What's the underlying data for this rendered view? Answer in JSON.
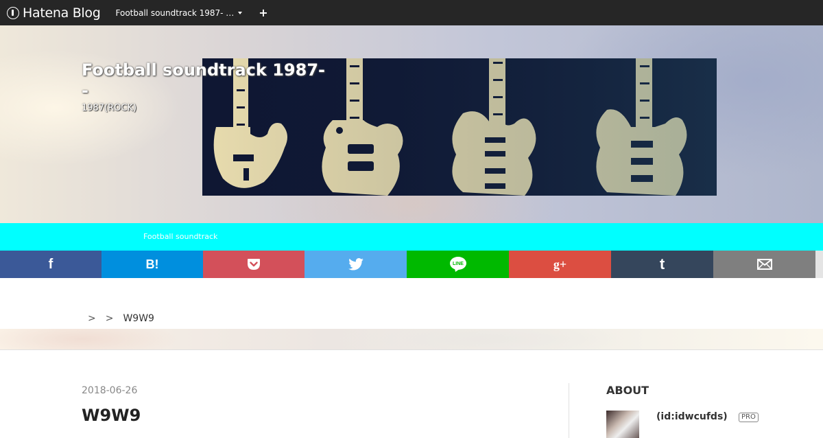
{
  "topbar": {
    "logo_text": "Hatena Blog",
    "blog_select_label": "Football soundtrack 1987-  …",
    "add_label": "+"
  },
  "header": {
    "title_line1": "Football soundtrack 1987-",
    "title_line2": "-",
    "description": "1987(ROCK)"
  },
  "nav": {
    "link": "Football soundtrack"
  },
  "share": {
    "facebook": "f",
    "hatena_bookmark": "B!",
    "google_plus": "g+",
    "tumblr": "t",
    "line": "LINE",
    "colors": {
      "facebook": "#3b5998",
      "hatena": "#008fde",
      "pocket": "#d3505a",
      "twitter": "#55acee",
      "line": "#00b900",
      "google_plus": "#dc4e41",
      "tumblr": "#35465c",
      "mail": "#7f7f7f"
    }
  },
  "breadcrumb": {
    "sep": ">",
    "current": "W9W9"
  },
  "entry": {
    "date": "2018-06-26",
    "title": "W9W9"
  },
  "sidebar": {
    "about_heading": "ABOUT",
    "user_id": "(id:idwcufds)",
    "pro_badge": "PRO"
  }
}
